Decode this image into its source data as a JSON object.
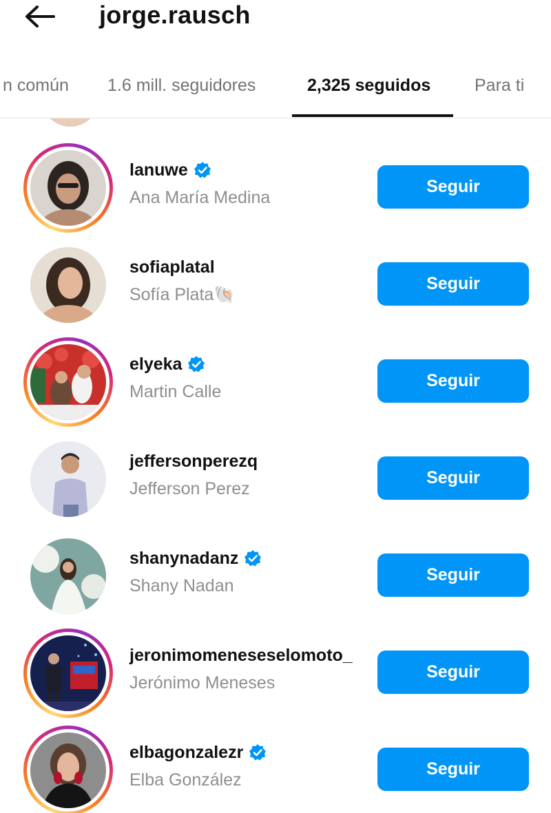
{
  "header": {
    "back_icon": "arrow-left-icon",
    "title": "jorge.rausch"
  },
  "tabs": [
    {
      "label": "n común",
      "active": false
    },
    {
      "label": "1.6 mill. seguidores",
      "active": false
    },
    {
      "label": "2,325 seguidos",
      "active": true
    },
    {
      "label": "Para ti",
      "active": false
    }
  ],
  "colors": {
    "accent": "#0095f6",
    "verified": "#0095f6",
    "secondary_text": "#8e8e8e"
  },
  "rows": [
    {
      "username": "lanuwe",
      "full_name": "Ana María Medina",
      "verified": true,
      "story_ring": true,
      "button": "Seguir"
    },
    {
      "username": "sofiaplatal",
      "full_name": "Sofía Plata🐚",
      "verified": false,
      "story_ring": false,
      "button": "Seguir"
    },
    {
      "username": "elyeka",
      "full_name": "Martin Calle",
      "verified": true,
      "story_ring": true,
      "button": "Seguir"
    },
    {
      "username": "jeffersonperezq",
      "full_name": "Jefferson Perez",
      "verified": false,
      "story_ring": false,
      "button": "Seguir"
    },
    {
      "username": "shanynadanz",
      "full_name": "Shany Nadan",
      "verified": true,
      "story_ring": false,
      "button": "Seguir"
    },
    {
      "username": "jeronimomeneseselomoto_",
      "full_name": "Jerónimo Meneses",
      "verified": false,
      "story_ring": true,
      "button": "Seguir"
    },
    {
      "username": "elbagonzalezr",
      "full_name": "Elba González",
      "verified": true,
      "story_ring": true,
      "button": "Seguir"
    }
  ]
}
